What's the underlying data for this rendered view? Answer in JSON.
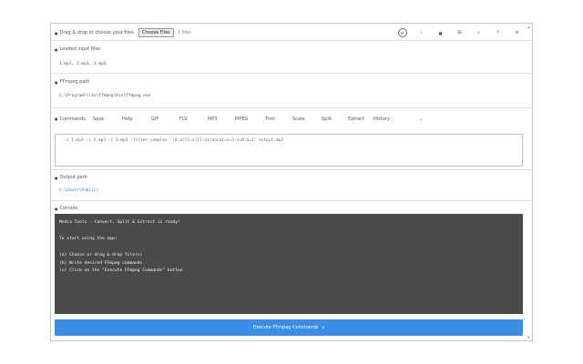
{
  "input": {
    "label": "Drag & drop or choose your files",
    "choose_button": "Choose Files",
    "file_status": "3 files"
  },
  "toolbar": {
    "items": [
      {
        "icon": "settings-icon",
        "glyph": "⚙"
      },
      {
        "icon": "chevron-right-icon",
        "glyph": "›"
      },
      {
        "icon": "stop-icon",
        "glyph": "■"
      },
      {
        "icon": "grid-icon",
        "glyph": "⊞"
      },
      {
        "icon": "search-icon",
        "glyph": "⌕"
      },
      {
        "icon": "help-icon",
        "glyph": "?"
      },
      {
        "icon": "menu-icon",
        "glyph": "≡"
      }
    ]
  },
  "loaded_files": {
    "label": "Loaded input files",
    "value": "1.mp3, 2.mp3, 3.mp3"
  },
  "ffmpeg_path": {
    "label": "FFmpeg path",
    "value": "C:\\ProgramFiles\\ffmpeg\\bin\\ffmpeg.exe"
  },
  "commands": {
    "label": "Commands",
    "tabs": [
      "Save",
      "Help",
      "GIF",
      "FLV",
      "MP3",
      "MPEG",
      "Trim",
      "Scale",
      "Split",
      "Extract",
      "History"
    ],
    "command_text": "-i 1.mp3 -i 2.mp3 -i 3.mp3 -filter_complex \"[0:a][1:a][2:a]concat=n=3:v=0:a=1\" output.mp3"
  },
  "output_path": {
    "label": "Output path",
    "value": "C:\\Users\\Public\\"
  },
  "console": {
    "label": "Console",
    "lines": [
      "Media Tools - Convert, Split & Extract is ready!",
      "",
      "To start using the app:",
      "",
      "(a) Choose or drag & drop file(s)",
      "(b) Write desired FFmpeg commands",
      "(c) Click on the \"Execute FFmpeg Commands\" button"
    ]
  },
  "execute_button": {
    "label": "Execute FFmpeg Commands",
    "icon": "chevron-right-icon"
  },
  "colors": {
    "accent": "#3a8ee6",
    "console_bg": "#4a4a4a",
    "link": "#4c6fc4"
  }
}
